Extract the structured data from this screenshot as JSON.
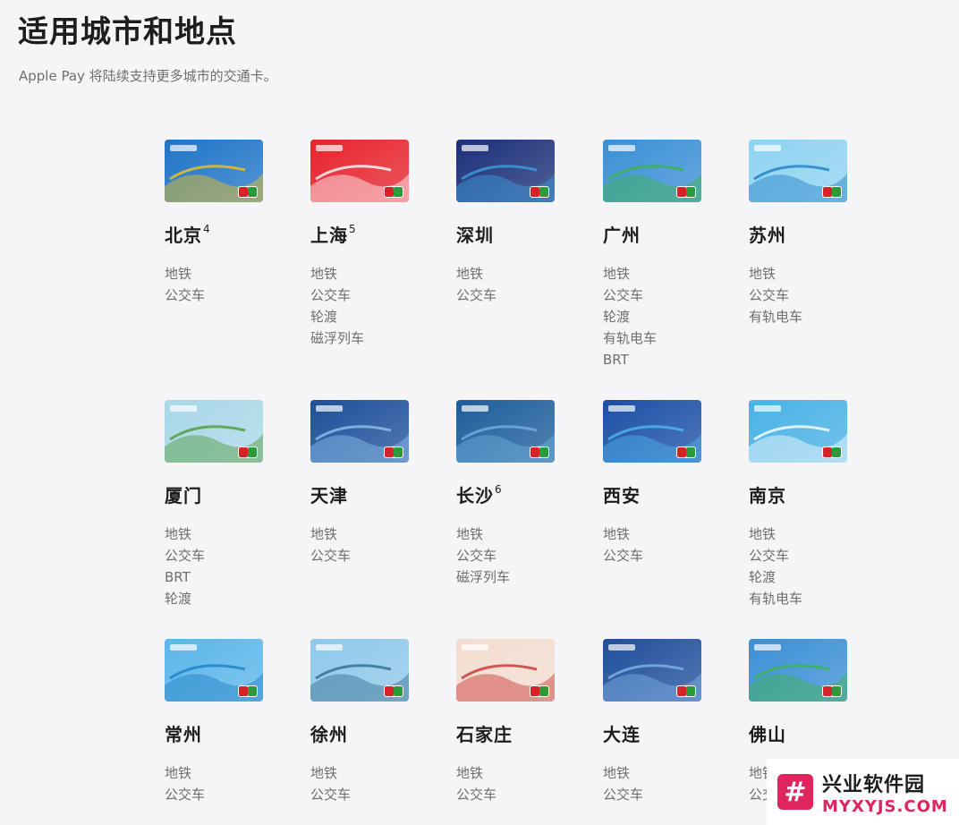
{
  "header": {
    "title": "适用城市和地点",
    "subtitle": "Apple Pay 将陆续支持更多城市的交通卡。"
  },
  "cities": [
    {
      "name": "北京",
      "note": "4",
      "modes": [
        "地铁",
        "公交车"
      ],
      "card": {
        "bg": "#1f74c8",
        "accent": "#f3c316",
        "icon": "beijing-card-icon"
      }
    },
    {
      "name": "上海",
      "note": "5",
      "modes": [
        "地铁",
        "公交车",
        "轮渡",
        "磁浮列车"
      ],
      "card": {
        "bg": "#e8232d",
        "accent": "#ffffff",
        "icon": "shanghai-card-icon"
      }
    },
    {
      "name": "深圳",
      "note": "",
      "modes": [
        "地铁",
        "公交车"
      ],
      "card": {
        "bg": "#1b2f78",
        "accent": "#3aa0e0",
        "icon": "shenzhen-card-icon"
      }
    },
    {
      "name": "广州",
      "note": "",
      "modes": [
        "地铁",
        "公交车",
        "轮渡",
        "有轨电车",
        "BRT"
      ],
      "card": {
        "bg": "#3a8fd6",
        "accent": "#3cb44a",
        "icon": "guangzhou-card-icon"
      }
    },
    {
      "name": "苏州",
      "note": "",
      "modes": [
        "地铁",
        "公交车",
        "有轨电车"
      ],
      "card": {
        "bg": "#8fd3f1",
        "accent": "#1c7fc7",
        "icon": "suzhou-card-icon"
      }
    },
    {
      "name": "厦门",
      "note": "",
      "modes": [
        "地铁",
        "公交车",
        "BRT",
        "轮渡"
      ],
      "card": {
        "bg": "#a9d8e8",
        "accent": "#4f9a3a",
        "icon": "xiamen-card-icon"
      }
    },
    {
      "name": "天津",
      "note": "",
      "modes": [
        "地铁",
        "公交车"
      ],
      "card": {
        "bg": "#1d4f9a",
        "accent": "#8ec3ee",
        "icon": "tianjin-card-icon"
      }
    },
    {
      "name": "长沙",
      "note": "6",
      "modes": [
        "地铁",
        "公交车",
        "磁浮列车"
      ],
      "card": {
        "bg": "#1d5d9b",
        "accent": "#6fb2e0",
        "icon": "changsha-card-icon"
      }
    },
    {
      "name": "西安",
      "note": "",
      "modes": [
        "地铁",
        "公交车"
      ],
      "card": {
        "bg": "#1a4fa6",
        "accent": "#4cb6f0",
        "icon": "xian-card-icon"
      }
    },
    {
      "name": "南京",
      "note": "",
      "modes": [
        "地铁",
        "公交车",
        "轮渡",
        "有轨电车"
      ],
      "card": {
        "bg": "#48b2e6",
        "accent": "#ffffff",
        "icon": "nanjing-card-icon"
      }
    },
    {
      "name": "常州",
      "note": "",
      "modes": [
        "地铁",
        "公交车"
      ],
      "card": {
        "bg": "#5ab6ea",
        "accent": "#1a7fc4",
        "icon": "changzhou-card-icon"
      }
    },
    {
      "name": "徐州",
      "note": "",
      "modes": [
        "地铁",
        "公交车"
      ],
      "card": {
        "bg": "#8ec9ea",
        "accent": "#2f6b8f",
        "icon": "xuzhou-card-icon"
      }
    },
    {
      "name": "石家庄",
      "note": "",
      "modes": [
        "地铁",
        "公交车"
      ],
      "card": {
        "bg": "#f4ddd0",
        "accent": "#c8322e",
        "icon": "shijiazhuang-card-icon"
      }
    },
    {
      "name": "大连",
      "note": "",
      "modes": [
        "地铁",
        "公交车"
      ],
      "card": {
        "bg": "#1f4e9c",
        "accent": "#7fb4e6",
        "icon": "dalian-card-icon"
      }
    },
    {
      "name": "佛山",
      "note": "",
      "modes": [
        "地铁",
        "公交车"
      ],
      "card": {
        "bg": "#3a8fd6",
        "accent": "#3cb44a",
        "icon": "foshan-card-icon"
      }
    }
  ],
  "watermark": {
    "cn": "兴业软件园",
    "en": "MYXYJS.COM",
    "logo": "#"
  }
}
